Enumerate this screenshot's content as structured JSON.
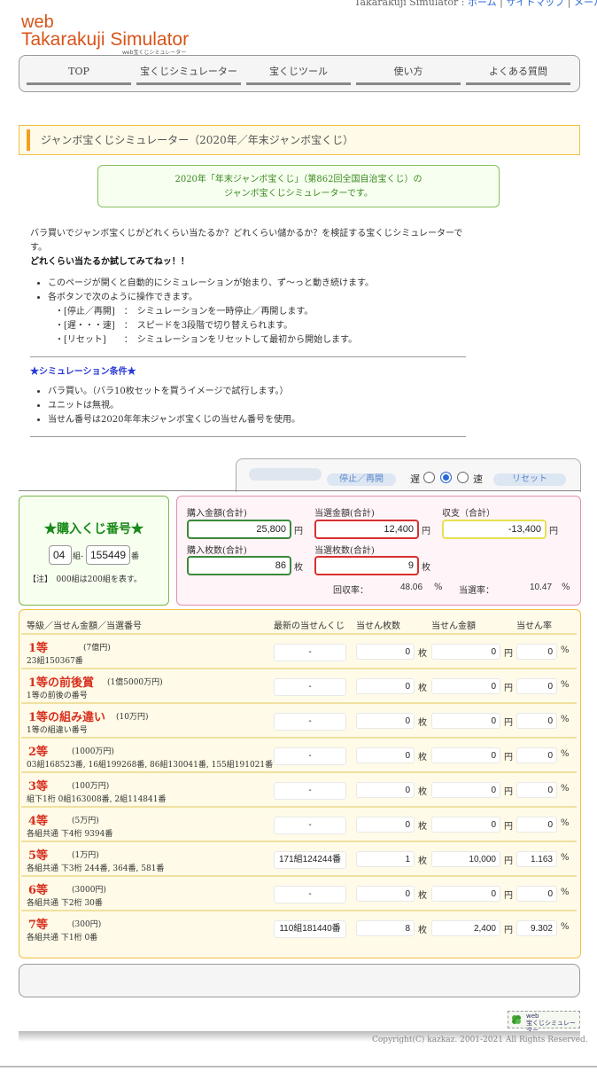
{
  "header": {
    "site_label": "Takarakuji Simulator :",
    "links": [
      "ホーム",
      "サイトマップ",
      "メール"
    ],
    "logo_web": "web",
    "logo_title": "Takarakuji Simulator",
    "logo_sub": "web宝くじシミュレーター"
  },
  "nav": [
    "TOP",
    "宝くじシミュレーター",
    "宝くじツール",
    "使い方",
    "よくある質問"
  ],
  "section_title": "ジャンボ宝くじシミュレーター（2020年／年末ジャンボ宝くじ）",
  "notice": {
    "line1": "2020年「年末ジャンボ宝くじ」（第862回全国自治宝くじ）の",
    "line2": "ジャンボ宝くじシミュレーターです。"
  },
  "description": {
    "para": "バラ買いでジャンボ宝くじがどれくらい当たるか？どれくらい儲かるか？を検証する宝くじシミュレーターです。",
    "bold": "どれくらい当たるか試してみてねッ！！",
    "bullets": [
      "このページが開くと自動的にシミュレーションが始まり、ず〜っと動き続けます。",
      "各ボタンで次のように操作できます。"
    ],
    "ops": [
      "・[停止／再開]　：　シミュレーションを一時停止／再開します。",
      "・[遅・・・速]　：　スピードを3段階で切り替えられます。",
      "・[リセット]　　：　シミュレーションをリセットして最初から開始します。"
    ]
  },
  "conditions": {
    "title": "★シミュレーション条件★",
    "items": [
      "バラ買い。（バラ10枚セットを買うイメージで試行します。）",
      "ユニットは無視。",
      "当せん番号は2020年年末ジャンボ宝くじの当せん番号を使用。"
    ]
  },
  "controls": {
    "pause_label": "停止／再開",
    "slow_label": "遅",
    "fast_label": "速",
    "reset_label": "リセット",
    "speed_selected": 2
  },
  "ticket": {
    "title": "★購入くじ番号★",
    "group": "04",
    "group_suffix": "組-",
    "number": "155449",
    "number_suffix": "番",
    "note": "【注】　000組は200組を表す。"
  },
  "stats": {
    "purchase_amount_label": "購入金額(合計)",
    "purchase_amount": "25,800",
    "win_amount_label": "当選金額(合計)",
    "win_amount": "12,400",
    "balance_label": "収支（合計）",
    "balance": "-13,400",
    "purchase_count_label": "購入枚数(合計)",
    "purchase_count": "86",
    "win_count_label": "当選枚数(合計)",
    "win_count": "9",
    "yen": "円",
    "mai": "枚",
    "return_rate_label": "回収率：",
    "return_rate": "48.06",
    "win_rate_label": "当選率：",
    "win_rate": "10.47",
    "pct": "%"
  },
  "table": {
    "headers": [
      "等級／当せん金額／当選番号",
      "最新の当せんくじ",
      "当せん枚数",
      "当せん金額",
      "当せん率"
    ],
    "rows": [
      {
        "name": "1等",
        "prize": "(7億円)",
        "numbers": "23組150367番",
        "latest": "-",
        "count": "0",
        "amount": "0",
        "rate": "0"
      },
      {
        "name": "1等の前後賞",
        "prize": "(1億5000万円)",
        "numbers": "1等の前後の番号",
        "latest": "-",
        "count": "0",
        "amount": "0",
        "rate": "0"
      },
      {
        "name": "1等の組み違い",
        "prize": "(10万円)",
        "numbers": "1等の組違い番号",
        "latest": "-",
        "count": "0",
        "amount": "0",
        "rate": "0"
      },
      {
        "name": "2等",
        "prize": "(1000万円)",
        "numbers": "03組168523番, 16組199268番, 86組130041番, 155組191021番",
        "latest": "-",
        "count": "0",
        "amount": "0",
        "rate": "0"
      },
      {
        "name": "3等",
        "prize": "(100万円)",
        "numbers": "組下1桁 0組163008番, 2組114841番",
        "latest": "-",
        "count": "0",
        "amount": "0",
        "rate": "0"
      },
      {
        "name": "4等",
        "prize": "(5万円)",
        "numbers": "各組共通 下4桁 9394番",
        "latest": "-",
        "count": "0",
        "amount": "0",
        "rate": "0"
      },
      {
        "name": "5等",
        "prize": "(1万円)",
        "numbers": "各組共通 下3桁 244番, 364番, 581番",
        "latest": "171組124244番",
        "count": "1",
        "amount": "10,000",
        "rate": "1.163"
      },
      {
        "name": "6等",
        "prize": "(3000円)",
        "numbers": "各組共通 下2桁 30番",
        "latest": "-",
        "count": "0",
        "amount": "0",
        "rate": "0"
      },
      {
        "name": "7等",
        "prize": "(300円)",
        "numbers": "各組共通 下1桁 0番",
        "latest": "110組181440番",
        "count": "8",
        "amount": "2,400",
        "rate": "9.302"
      }
    ]
  },
  "badge": {
    "line1": "web",
    "line2": "宝くじシミュレーター"
  },
  "footer": "Copyright(C) kazkaz. 2001-2021 All Rights Reserved."
}
